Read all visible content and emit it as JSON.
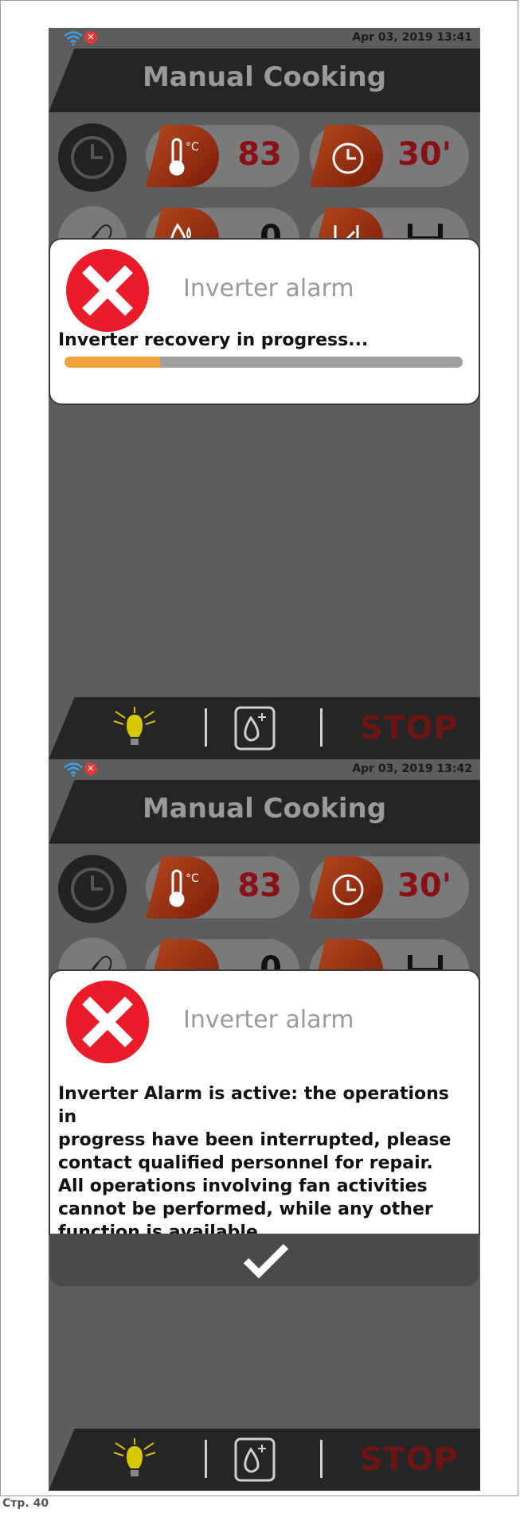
{
  "screens": [
    {
      "status": {
        "datetime": "Apr 03, 2019  13:41",
        "wifi_icon": "wifi-icon",
        "error_icon": "error-x-icon"
      },
      "title": "Manual Cooking",
      "controls": {
        "temperature_value": "83",
        "time_value": "30'",
        "humidity_value": "0"
      },
      "dialog": {
        "title": "Inverter alarm",
        "message": "Inverter recovery in progress...",
        "progress": 0.24
      },
      "bottombar": {
        "stop_label": "STOP"
      }
    },
    {
      "status": {
        "datetime": "Apr 03, 2019  13:42",
        "wifi_icon": "wifi-icon",
        "error_icon": "error-x-icon"
      },
      "title": "Manual Cooking",
      "controls": {
        "temperature_value": "83",
        "time_value": "30'",
        "humidity_value": "0"
      },
      "dialog": {
        "title": "Inverter alarm",
        "message_lines": [
          "Inverter Alarm is active: the operations in",
          "progress have been interrupted, please",
          "contact qualified personnel for repair.",
          "All operations involving fan activities",
          "cannot be performed, while any other",
          "function is available"
        ],
        "confirm_icon": "checkmark-icon"
      },
      "bottombar": {
        "stop_label": "STOP"
      }
    }
  ],
  "page_label": "Стр. 40",
  "colors": {
    "accent_red": "#ea1c2a",
    "progress_fill": "#f2a33a",
    "value_red": "#8a1018"
  }
}
